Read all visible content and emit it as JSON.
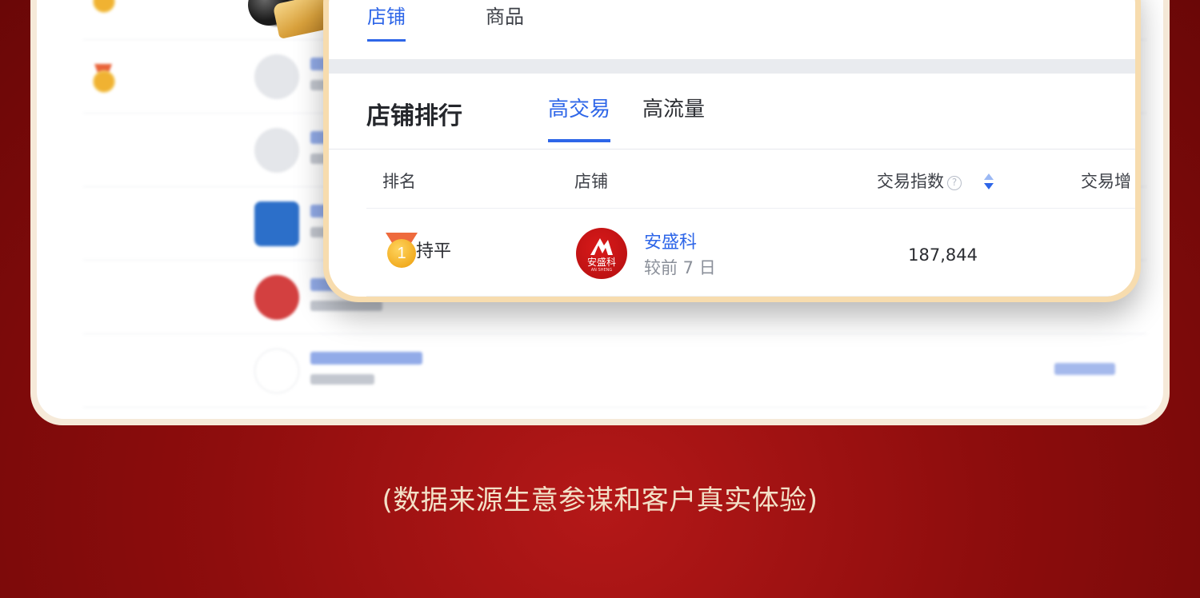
{
  "panel": {
    "top_tabs": [
      {
        "label": "店铺",
        "active": true
      },
      {
        "label": "商品",
        "active": false
      }
    ],
    "section_title": "店铺排行",
    "sub_tabs": [
      {
        "label": "高交易",
        "active": true
      },
      {
        "label": "高流量",
        "active": false
      }
    ],
    "columns": {
      "rank": "排名",
      "shop": "店铺",
      "trade_index": "交易指数",
      "trade_growth": "交易增"
    },
    "help_icon": "question-circle-icon",
    "sort_icon": "sort-caret-icon",
    "rows": [
      {
        "rank": "1",
        "rank_change": "持平",
        "shop_logo_text": "安盛科",
        "shop_logo_sub": "AN SHENG",
        "shop_name": "安盛科",
        "shop_sub": "较前 7 日",
        "trade_index": "187,844"
      }
    ]
  },
  "colors": {
    "accent": "#2e66e8",
    "background": "#8e0d0d",
    "card_border": "#f7dcae",
    "caption": "#f3e1c8"
  },
  "caption": "(数据来源生意参谋和客户真实体验)"
}
